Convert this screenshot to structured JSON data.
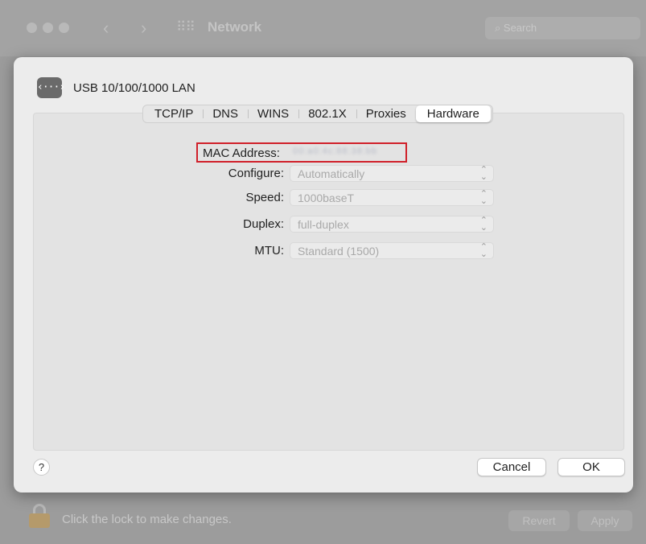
{
  "background_window": {
    "title": "Network",
    "search_placeholder": "Search",
    "nav_back": "‹",
    "nav_forward": "›",
    "grid_icon": "grid-icon",
    "lock_text": "Click the lock to make changes.",
    "revert_label": "Revert",
    "apply_label": "Apply"
  },
  "sheet": {
    "interface_icon": "ethernet-icon",
    "interface_icon_glyph": "‹···›",
    "interface_name": "USB 10/100/1000 LAN",
    "tabs": [
      {
        "label": "TCP/IP",
        "active": false
      },
      {
        "label": "DNS",
        "active": false
      },
      {
        "label": "WINS",
        "active": false
      },
      {
        "label": "802.1X",
        "active": false
      },
      {
        "label": "Proxies",
        "active": false
      },
      {
        "label": "Hardware",
        "active": true
      }
    ],
    "mac_address": {
      "label": "MAC Address:",
      "value": "00:a0:4c:88:38:bb"
    },
    "fields": [
      {
        "label": "Configure:",
        "value": "Automatically"
      },
      {
        "label": "Speed:",
        "value": "1000baseT"
      },
      {
        "label": "Duplex:",
        "value": "full-duplex"
      },
      {
        "label": "MTU:",
        "value": "Standard (1500)"
      }
    ],
    "help_label": "?",
    "cancel_label": "Cancel",
    "ok_label": "OK"
  },
  "colors": {
    "highlight": "#d0202a",
    "sheet_bg": "#ececec"
  }
}
